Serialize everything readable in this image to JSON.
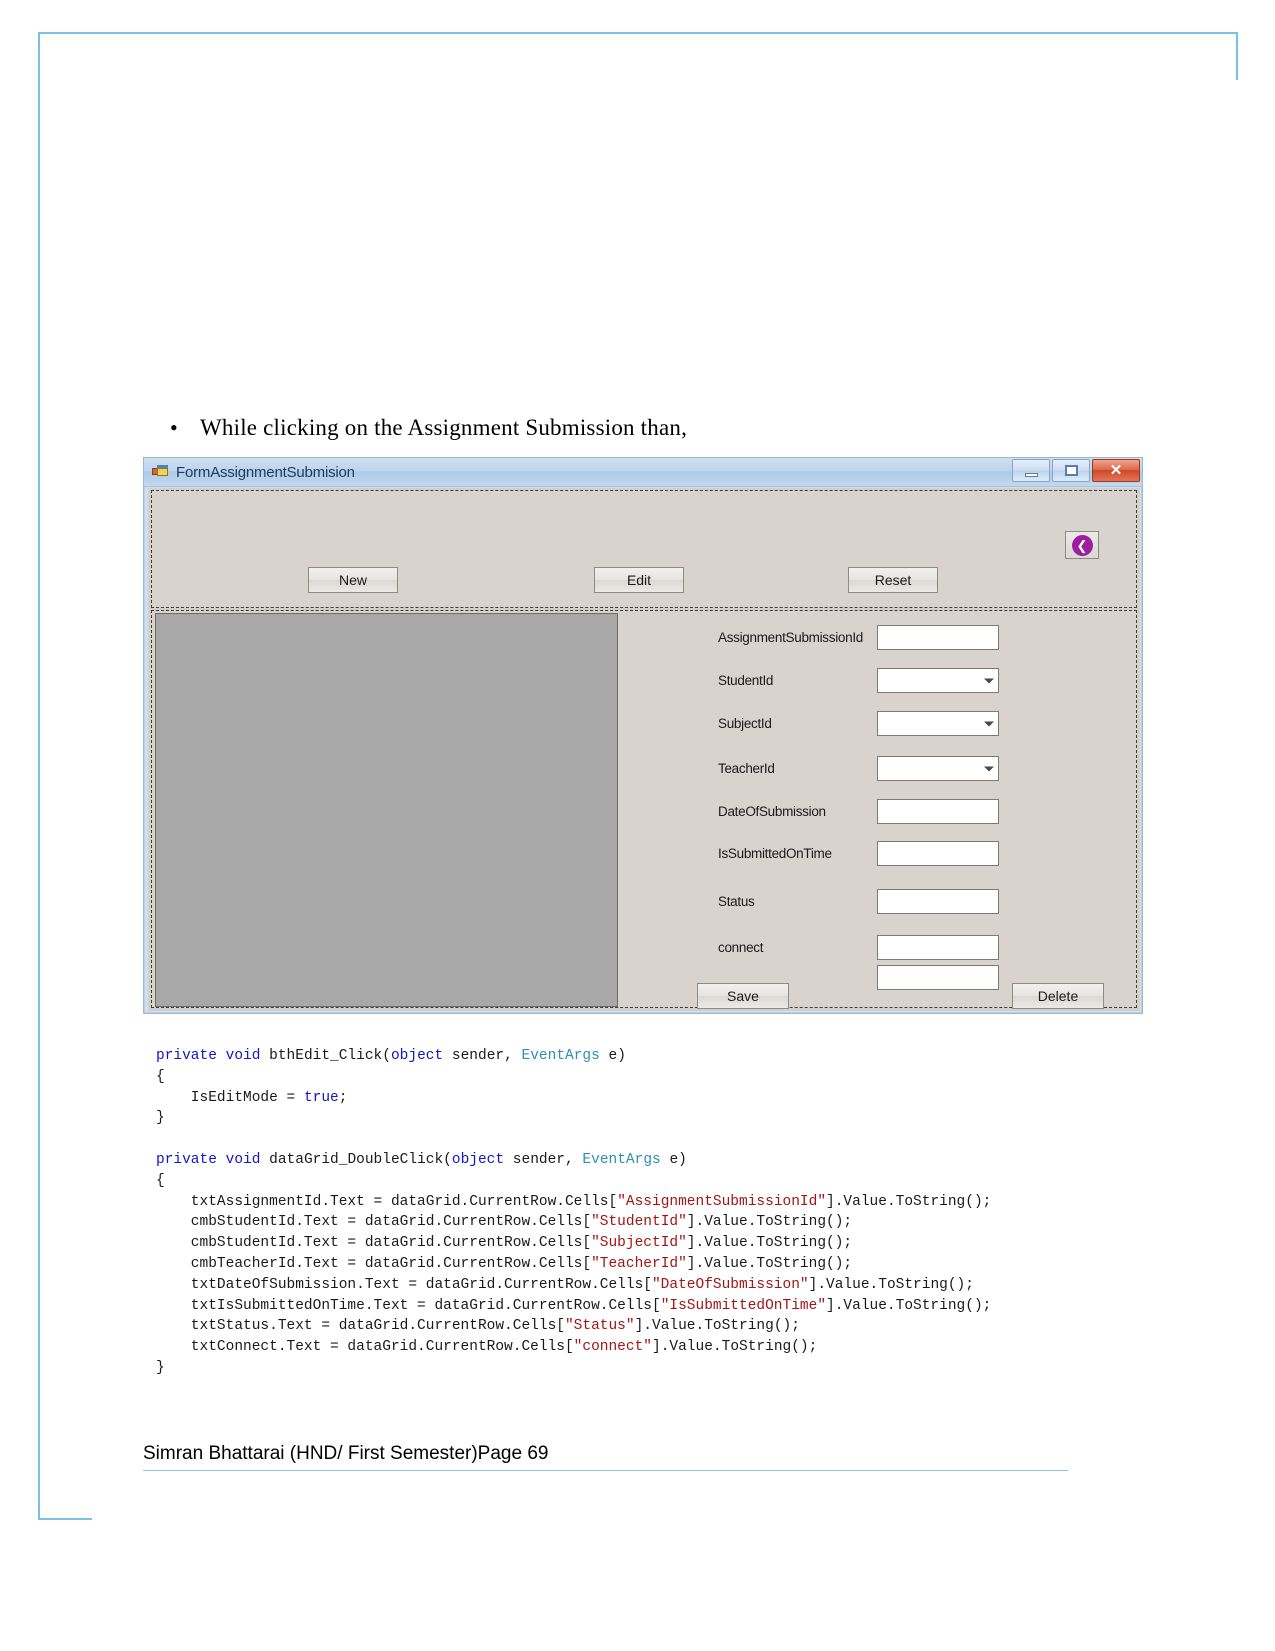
{
  "document": {
    "bullet_symbol": "•",
    "bullet_text": "While clicking on the Assignment Submission than,",
    "footer_text": "Simran Bhattarai (HND/ First Semester)Page 69"
  },
  "winform": {
    "title": "FormAssignmentSubmision",
    "icon": "form-icon",
    "window_controls": {
      "minimize": "minimize-icon",
      "maximize": "maximize-icon",
      "close_glyph": "✕"
    },
    "toolbar_buttons": [
      {
        "label": "New",
        "name": "new-button"
      },
      {
        "label": "Edit",
        "name": "edit-button"
      },
      {
        "label": "Reset",
        "name": "reset-button"
      }
    ],
    "back_button": {
      "glyph": "❮",
      "color": "#9c1fa0"
    },
    "fields": [
      {
        "label": "AssignmentSubmissionId",
        "type": "textbox",
        "value": ""
      },
      {
        "label": "StudentId",
        "type": "combobox",
        "value": ""
      },
      {
        "label": "SubjectId",
        "type": "combobox",
        "value": ""
      },
      {
        "label": "TeacherId",
        "type": "combobox",
        "value": ""
      },
      {
        "label": "DateOfSubmission",
        "type": "textbox",
        "value": ""
      },
      {
        "label": "IsSubmittedOnTime",
        "type": "textbox",
        "value": ""
      },
      {
        "label": "Status",
        "type": "textbox",
        "value": ""
      },
      {
        "label": "connect",
        "type": "textbox",
        "value": ""
      },
      {
        "label": "",
        "type": "textbox",
        "value": ""
      }
    ],
    "action_buttons": [
      {
        "label": "Save",
        "name": "save-button"
      },
      {
        "label": "Delete",
        "name": "delete-button"
      }
    ]
  },
  "code": {
    "language": "csharp",
    "lines": [
      [
        {
          "t": "private",
          "c": "kw"
        },
        {
          "t": " ",
          "c": "id"
        },
        {
          "t": "void",
          "c": "kw"
        },
        {
          "t": " bthEdit_Click(",
          "c": "id"
        },
        {
          "t": "object",
          "c": "kw"
        },
        {
          "t": " sender, ",
          "c": "id"
        },
        {
          "t": "EventArgs",
          "c": "ty"
        },
        {
          "t": " e)",
          "c": "id"
        }
      ],
      [
        {
          "t": "{",
          "c": "id"
        }
      ],
      [
        {
          "t": "    IsEditMode = ",
          "c": "id"
        },
        {
          "t": "true",
          "c": "kw"
        },
        {
          "t": ";",
          "c": "id"
        }
      ],
      [
        {
          "t": "}",
          "c": "id"
        }
      ],
      [
        {
          "t": "",
          "c": "id"
        }
      ],
      [
        {
          "t": "private",
          "c": "kw"
        },
        {
          "t": " ",
          "c": "id"
        },
        {
          "t": "void",
          "c": "kw"
        },
        {
          "t": " dataGrid_DoubleClick(",
          "c": "id"
        },
        {
          "t": "object",
          "c": "kw"
        },
        {
          "t": " sender, ",
          "c": "id"
        },
        {
          "t": "EventArgs",
          "c": "ty"
        },
        {
          "t": " e)",
          "c": "id"
        }
      ],
      [
        {
          "t": "{",
          "c": "id"
        }
      ],
      [
        {
          "t": "    txtAssignmentId.Text = dataGrid.CurrentRow.Cells[",
          "c": "id"
        },
        {
          "t": "\"AssignmentSubmissionId\"",
          "c": "str"
        },
        {
          "t": "].Value.ToString();",
          "c": "id"
        }
      ],
      [
        {
          "t": "    cmbStudentId.Text = dataGrid.CurrentRow.Cells[",
          "c": "id"
        },
        {
          "t": "\"StudentId\"",
          "c": "str"
        },
        {
          "t": "].Value.ToString();",
          "c": "id"
        }
      ],
      [
        {
          "t": "    cmbStudentId.Text = dataGrid.CurrentRow.Cells[",
          "c": "id"
        },
        {
          "t": "\"SubjectId\"",
          "c": "str"
        },
        {
          "t": "].Value.ToString();",
          "c": "id"
        }
      ],
      [
        {
          "t": "    cmbTeacherId.Text = dataGrid.CurrentRow.Cells[",
          "c": "id"
        },
        {
          "t": "\"TeacherId\"",
          "c": "str"
        },
        {
          "t": "].Value.ToString();",
          "c": "id"
        }
      ],
      [
        {
          "t": "    txtDateOfSubmission.Text = dataGrid.CurrentRow.Cells[",
          "c": "id"
        },
        {
          "t": "\"DateOfSubmission\"",
          "c": "str"
        },
        {
          "t": "].Value.ToString();",
          "c": "id"
        }
      ],
      [
        {
          "t": "    txtIsSubmittedOnTime.Text = dataGrid.CurrentRow.Cells[",
          "c": "id"
        },
        {
          "t": "\"IsSubmittedOnTime\"",
          "c": "str"
        },
        {
          "t": "].Value.ToString();",
          "c": "id"
        }
      ],
      [
        {
          "t": "    txtStatus.Text = dataGrid.CurrentRow.Cells[",
          "c": "id"
        },
        {
          "t": "\"Status\"",
          "c": "str"
        },
        {
          "t": "].Value.ToString();",
          "c": "id"
        }
      ],
      [
        {
          "t": "    txtConnect.Text = dataGrid.CurrentRow.Cells[",
          "c": "id"
        },
        {
          "t": "\"connect\"",
          "c": "str"
        },
        {
          "t": "].Value.ToString();",
          "c": "id"
        }
      ],
      [
        {
          "t": "}",
          "c": "id"
        }
      ]
    ]
  },
  "colors": {
    "page_border": "#76c5e0",
    "form_chrome": "#cfdff0",
    "form_face": "#d8d4cd",
    "grid_fill": "#a8a8a8",
    "close_button": "#cf4a26",
    "back_accent": "#9c1fa0",
    "code_keyword": "#1414c8",
    "code_type": "#2b91af",
    "code_string": "#a31515"
  }
}
